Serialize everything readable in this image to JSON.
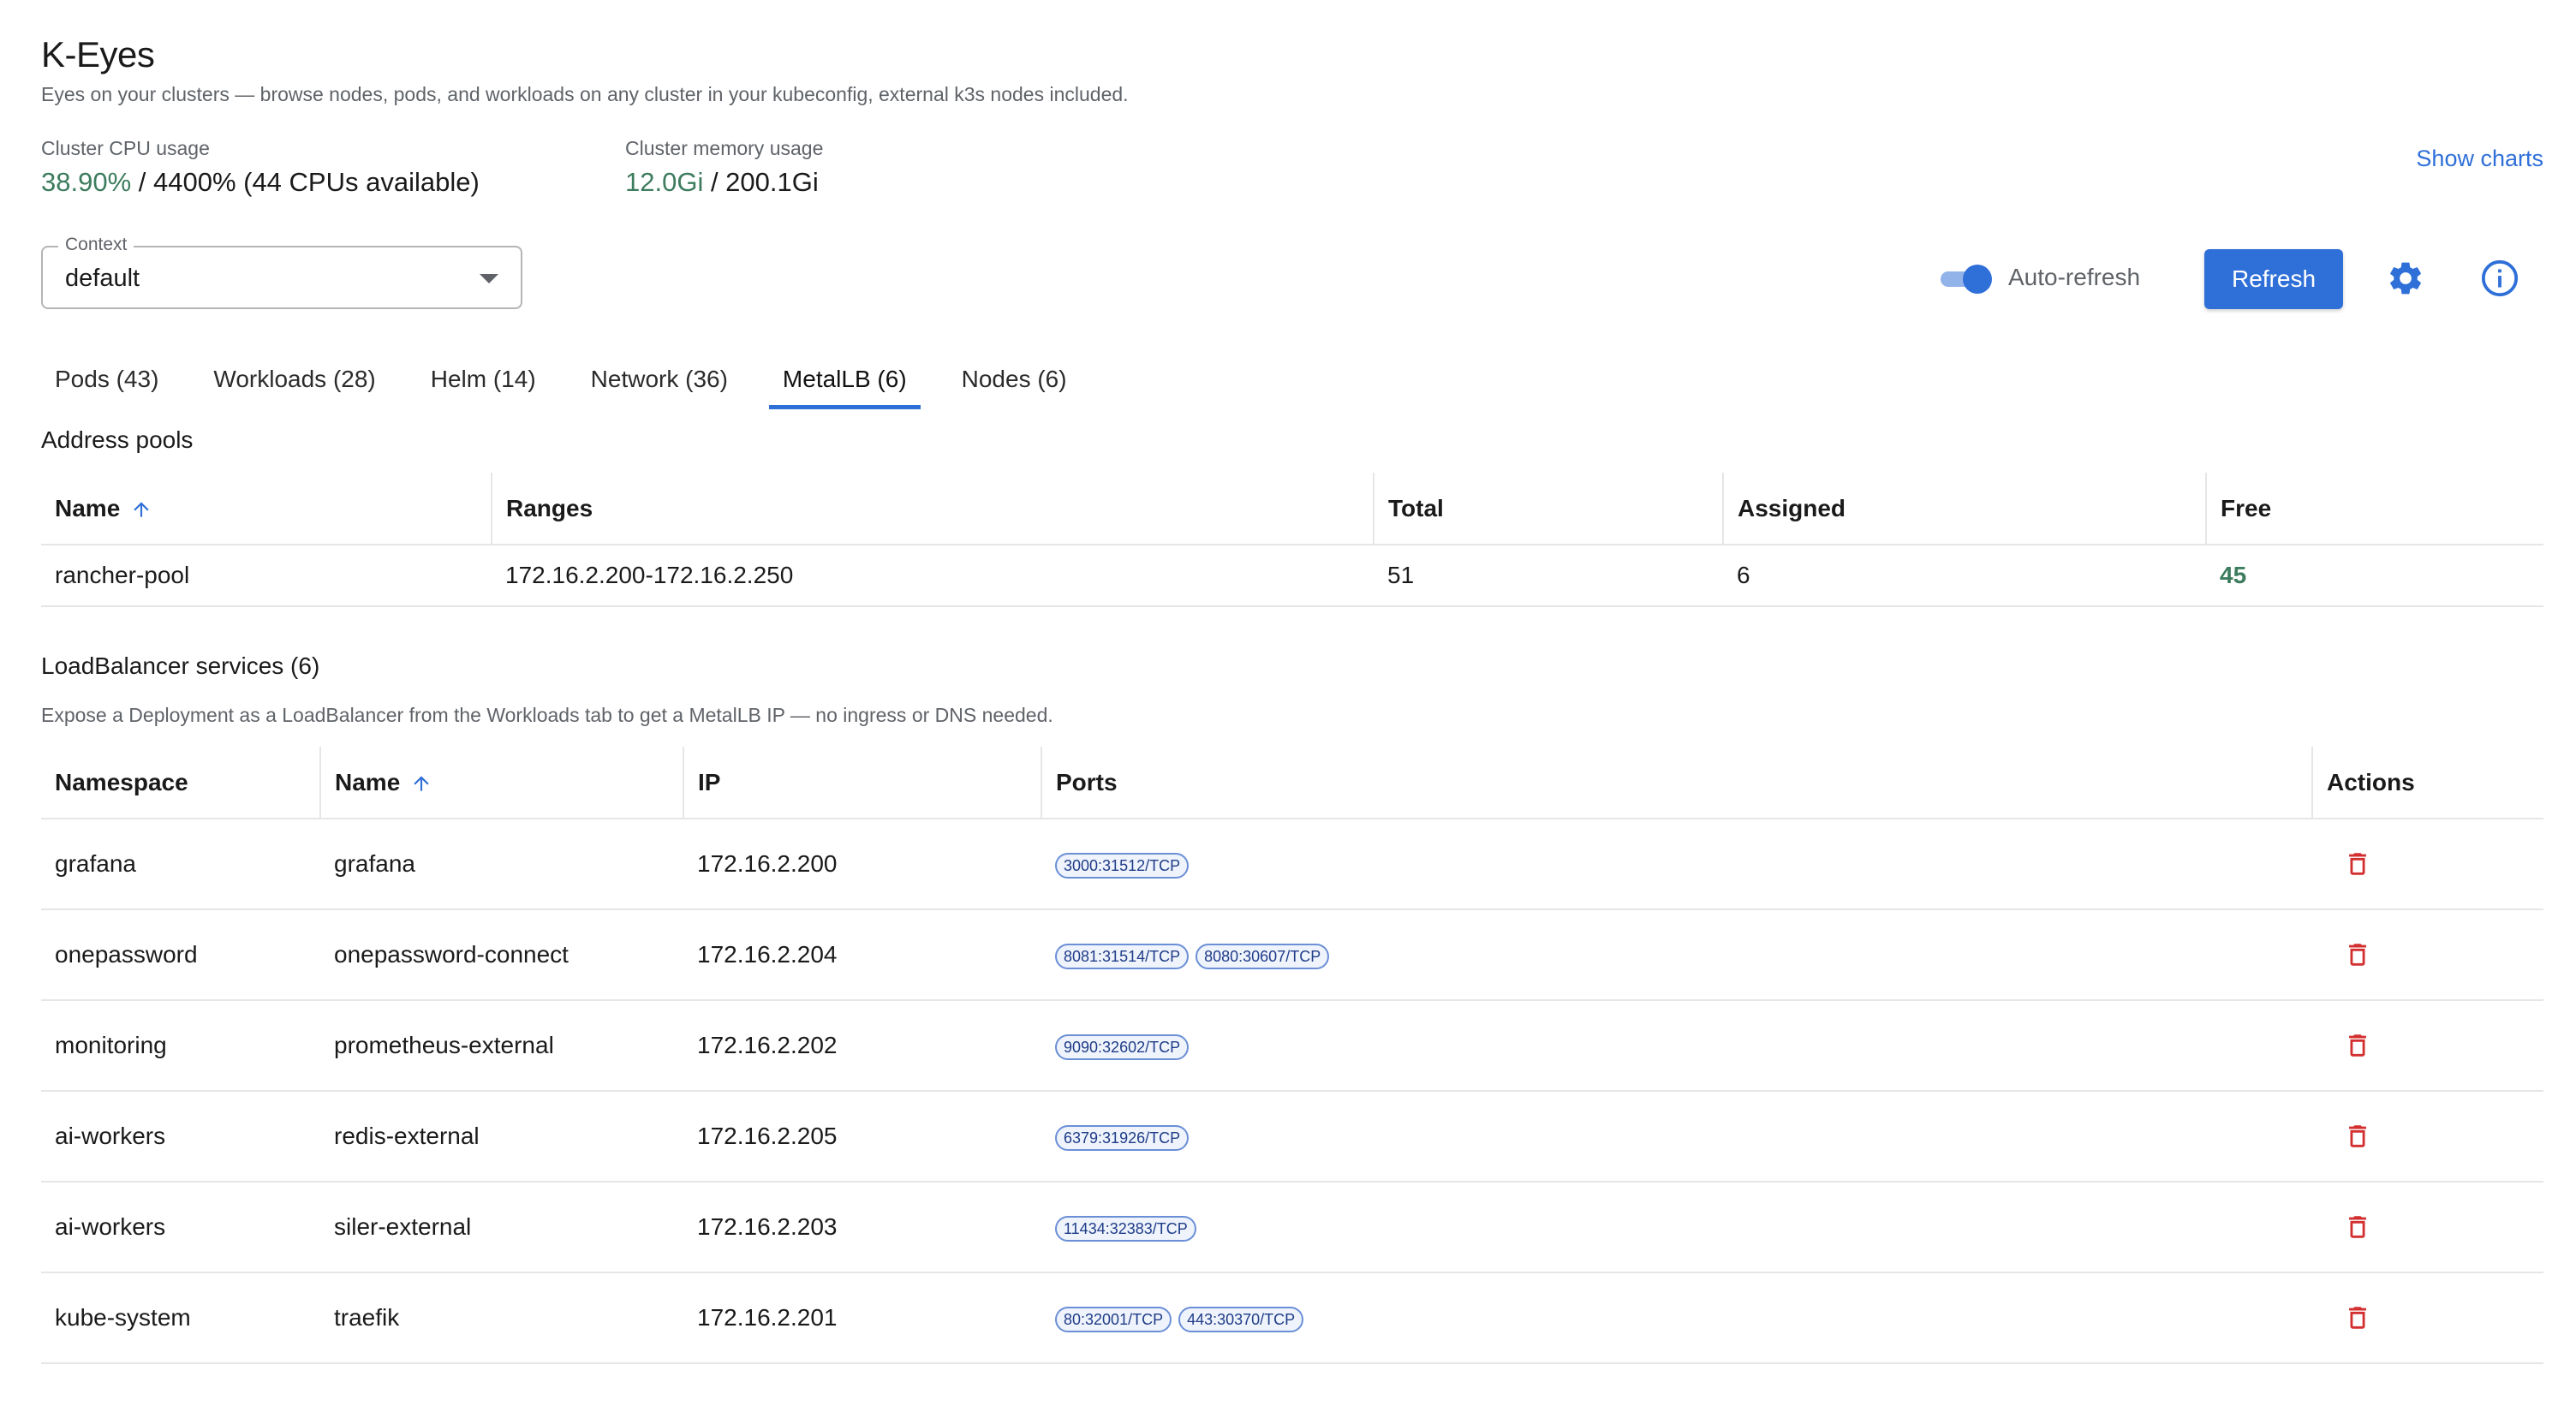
{
  "app": {
    "title": "K-Eyes",
    "subtitle": "Eyes on your clusters — browse nodes, pods, and workloads on any cluster in your kubeconfig, external k3s nodes included."
  },
  "usage": {
    "cpu_label": "Cluster CPU usage",
    "cpu_used": "38.90%",
    "cpu_rest": " / 4400% (44 CPUs available)",
    "mem_label": "Cluster memory usage",
    "mem_used": "12.0Gi",
    "mem_rest": " / 200.1Gi"
  },
  "show_charts_label": "Show charts",
  "context": {
    "label": "Context",
    "value": "default"
  },
  "auto_refresh": {
    "label": "Auto-refresh",
    "enabled": true
  },
  "refresh_label": "Refresh",
  "tabs": [
    {
      "label": "Pods (43)",
      "active": false
    },
    {
      "label": "Workloads (28)",
      "active": false
    },
    {
      "label": "Helm (14)",
      "active": false
    },
    {
      "label": "Network (36)",
      "active": false
    },
    {
      "label": "MetalLB (6)",
      "active": true
    },
    {
      "label": "Nodes (6)",
      "active": false
    }
  ],
  "address_pools": {
    "title": "Address pools",
    "columns": [
      "Name",
      "Ranges",
      "Total",
      "Assigned",
      "Free"
    ],
    "rows": [
      {
        "name": "rancher-pool",
        "ranges": "172.16.2.200-172.16.2.250",
        "total": "51",
        "assigned": "6",
        "free": "45"
      }
    ]
  },
  "lb_services": {
    "title": "LoadBalancer services (6)",
    "note": "Expose a Deployment as a LoadBalancer from the Workloads tab to get a MetalLB IP — no ingress or DNS needed.",
    "columns": [
      "Namespace",
      "Name",
      "IP",
      "Ports",
      "Actions"
    ],
    "rows": [
      {
        "namespace": "grafana",
        "name": "grafana",
        "ip": "172.16.2.200",
        "ports": [
          "3000:31512/TCP"
        ]
      },
      {
        "namespace": "onepassword",
        "name": "onepassword-connect",
        "ip": "172.16.2.204",
        "ports": [
          "8081:31514/TCP",
          "8080:30607/TCP"
        ]
      },
      {
        "namespace": "monitoring",
        "name": "prometheus-external",
        "ip": "172.16.2.202",
        "ports": [
          "9090:32602/TCP"
        ]
      },
      {
        "namespace": "ai-workers",
        "name": "redis-external",
        "ip": "172.16.2.205",
        "ports": [
          "6379:31926/TCP"
        ]
      },
      {
        "namespace": "ai-workers",
        "name": "siler-external",
        "ip": "172.16.2.203",
        "ports": [
          "11434:32383/TCP"
        ]
      },
      {
        "namespace": "kube-system",
        "name": "traefik",
        "ip": "172.16.2.201",
        "ports": [
          "80:32001/TCP",
          "443:30370/TCP"
        ]
      }
    ]
  },
  "colors": {
    "accent": "#2f6fd8",
    "positive": "#3d7c5e",
    "danger": "#d32f2f",
    "muted_text": "#5f6368"
  }
}
